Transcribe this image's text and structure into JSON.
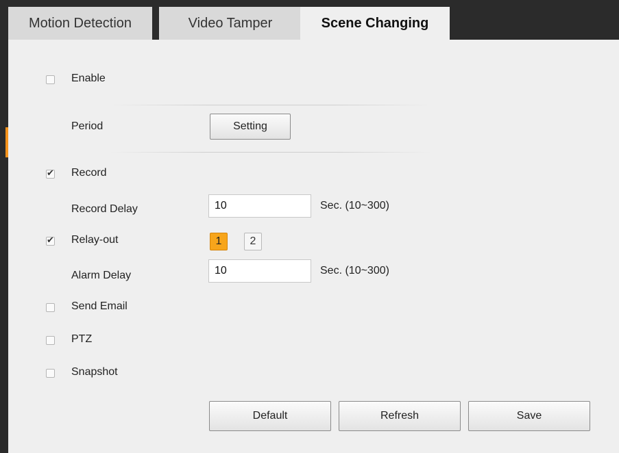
{
  "tabs": [
    {
      "label": "Motion Detection"
    },
    {
      "label": "Video Tamper"
    },
    {
      "label": "Scene Changing"
    }
  ],
  "enable": {
    "label": "Enable",
    "checked": false
  },
  "period": {
    "label": "Period",
    "button_label": "Setting"
  },
  "record": {
    "label": "Record",
    "checked": true
  },
  "record_delay": {
    "label": "Record Delay",
    "value": "10",
    "unit": "Sec. (10~300)"
  },
  "relay_out": {
    "label": "Relay-out",
    "checked": true,
    "channels": [
      "1",
      "2"
    ],
    "selected": "1"
  },
  "alarm_delay": {
    "label": "Alarm Delay",
    "value": "10",
    "unit": "Sec. (10~300)"
  },
  "send_email": {
    "label": "Send Email",
    "checked": false
  },
  "ptz": {
    "label": "PTZ",
    "checked": false
  },
  "snapshot": {
    "label": "Snapshot",
    "checked": false
  },
  "actions": {
    "default_label": "Default",
    "refresh_label": "Refresh",
    "save_label": "Save"
  },
  "colors": {
    "accent": "#f7a51b",
    "background": "#efefef",
    "dark": "#2b2b2b"
  }
}
